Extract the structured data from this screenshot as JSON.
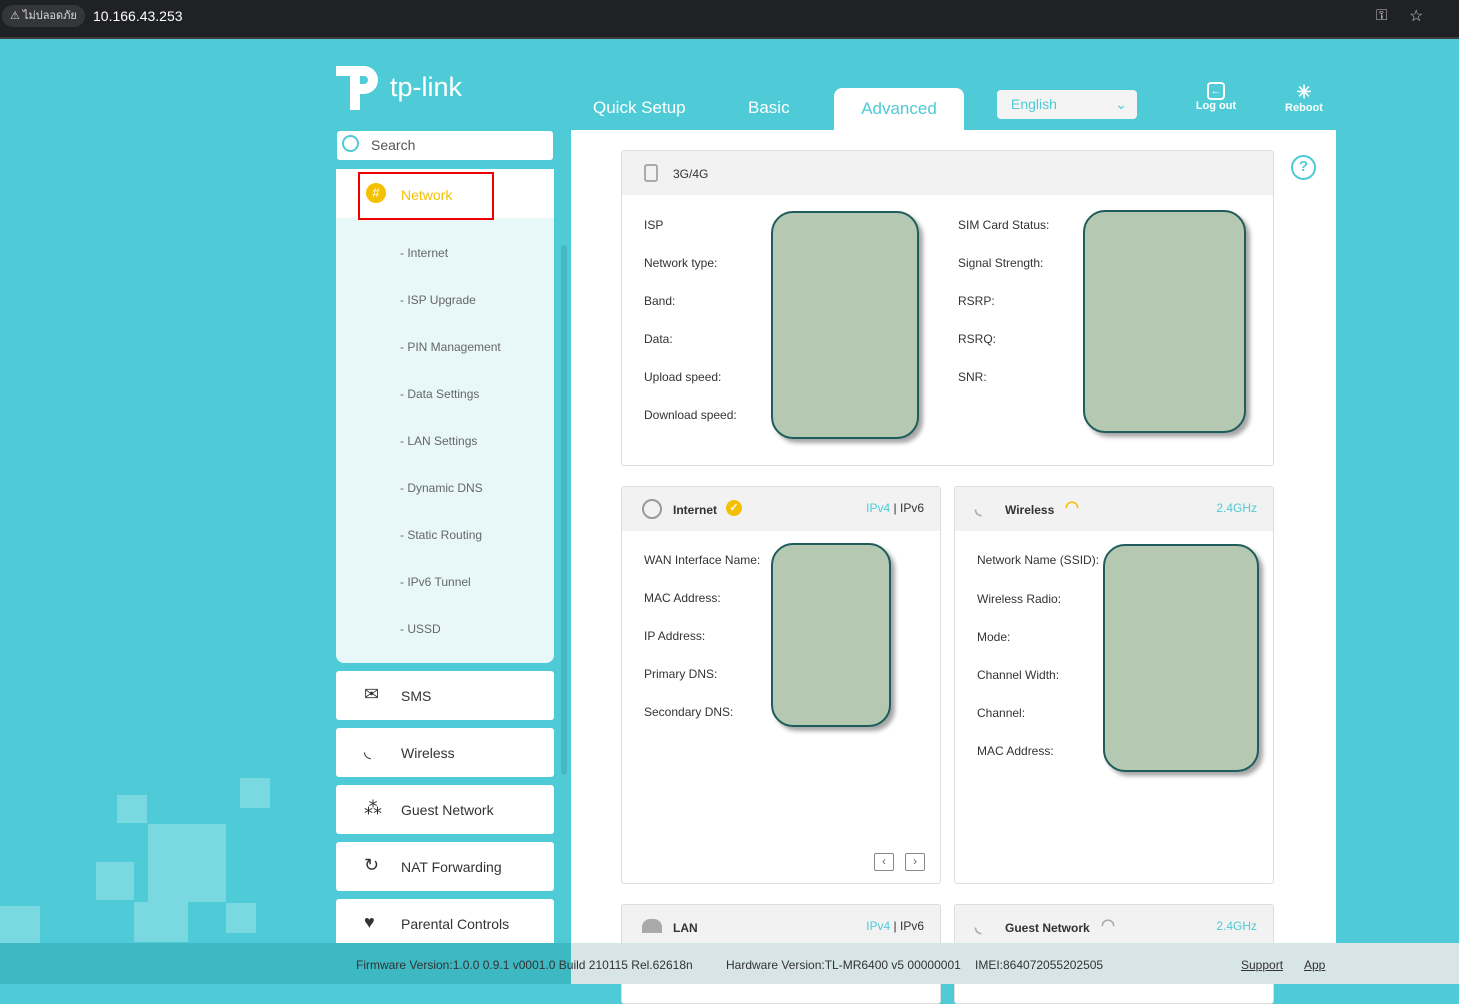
{
  "browser": {
    "security_label": "ไม่ปลอดภัย",
    "url": "10.166.43.253"
  },
  "header": {
    "brand": "tp-link",
    "tabs": [
      "Quick Setup",
      "Basic",
      "Advanced"
    ],
    "language": "English",
    "logout": "Log out",
    "reboot": "Reboot"
  },
  "sidebar": {
    "search_placeholder": "Search",
    "network": "Network",
    "sub_items": [
      "- Internet",
      "- ISP Upgrade",
      "- PIN Management",
      "- Data Settings",
      "- LAN Settings",
      "- Dynamic DNS",
      "- Static Routing",
      "- IPv6 Tunnel",
      "- USSD"
    ],
    "items": [
      "SMS",
      "Wireless",
      "Guest Network",
      "NAT Forwarding",
      "Parental Controls"
    ]
  },
  "cards": {
    "mobile": {
      "title": "3G/4G",
      "left_labels": [
        "ISP",
        "Network type:",
        "Band:",
        "Data:",
        "Upload speed:",
        "Download speed:"
      ],
      "right_labels": [
        "SIM Card Status:",
        "Signal Strength:",
        "RSRP:",
        "RSRQ:",
        "SNR:"
      ]
    },
    "internet": {
      "title": "Internet",
      "ipv4": "IPv4",
      "sep": "|",
      "ipv6": "IPv6",
      "labels": [
        "WAN Interface Name:",
        "MAC Address:",
        "IP Address:",
        "Primary DNS:",
        "Secondary DNS:"
      ]
    },
    "wireless": {
      "title": "Wireless",
      "band": "2.4GHz",
      "labels": [
        "Network Name (SSID):",
        "Wireless Radio:",
        "Mode:",
        "Channel Width:",
        "Channel:",
        "MAC Address:"
      ]
    },
    "lan": {
      "title": "LAN",
      "ipv4": "IPv4",
      "sep": "|",
      "ipv6": "IPv6"
    },
    "guest": {
      "title": "Guest Network",
      "band": "2.4GHz"
    }
  },
  "footer": {
    "firmware": "Firmware Version:1.0.0 0.9.1 v0001.0 Build 210115 Rel.62618n",
    "hardware": "Hardware Version:TL-MR6400 v5 00000001",
    "imei": "IMEI:864072055202505",
    "support": "Support",
    "app": "App"
  },
  "colors": {
    "accent": "#4ecbd6",
    "warn": "#f5c000"
  }
}
